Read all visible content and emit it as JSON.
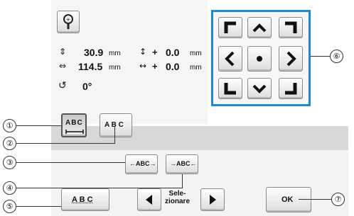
{
  "info": {
    "height_value": "30.9",
    "width_value": "114.5",
    "unit": "mm",
    "vertical_offset": "0.0",
    "horizontal_offset": "0.0",
    "offset_sign": "+",
    "rotation_value": "0°"
  },
  "buttons": {
    "abc_arc_label": "ABC",
    "abc_spacing_label": "A B C",
    "abc_wide_label": "ABC",
    "abc_narrow_label": "ABC",
    "abc_underline_label": "A B C",
    "select_label": "Sele-\nzionare",
    "ok_label": "OK"
  },
  "callouts": [
    "①",
    "②",
    "③",
    "④",
    "⑤",
    "⑥",
    "⑦"
  ],
  "icons": {
    "magnify": "magnifier-icon",
    "dir_up_left": "corner-up-left-icon",
    "dir_up": "chevron-up-icon",
    "dir_up_right": "corner-up-right-icon",
    "dir_left": "chevron-left-icon",
    "dir_center": "dot-icon",
    "dir_right": "chevron-right-icon",
    "dir_down_left": "corner-down-left-icon",
    "dir_down": "chevron-down-icon",
    "dir_down_right": "corner-down-right-icon"
  },
  "colors": {
    "accent": "#1d8ad6"
  }
}
